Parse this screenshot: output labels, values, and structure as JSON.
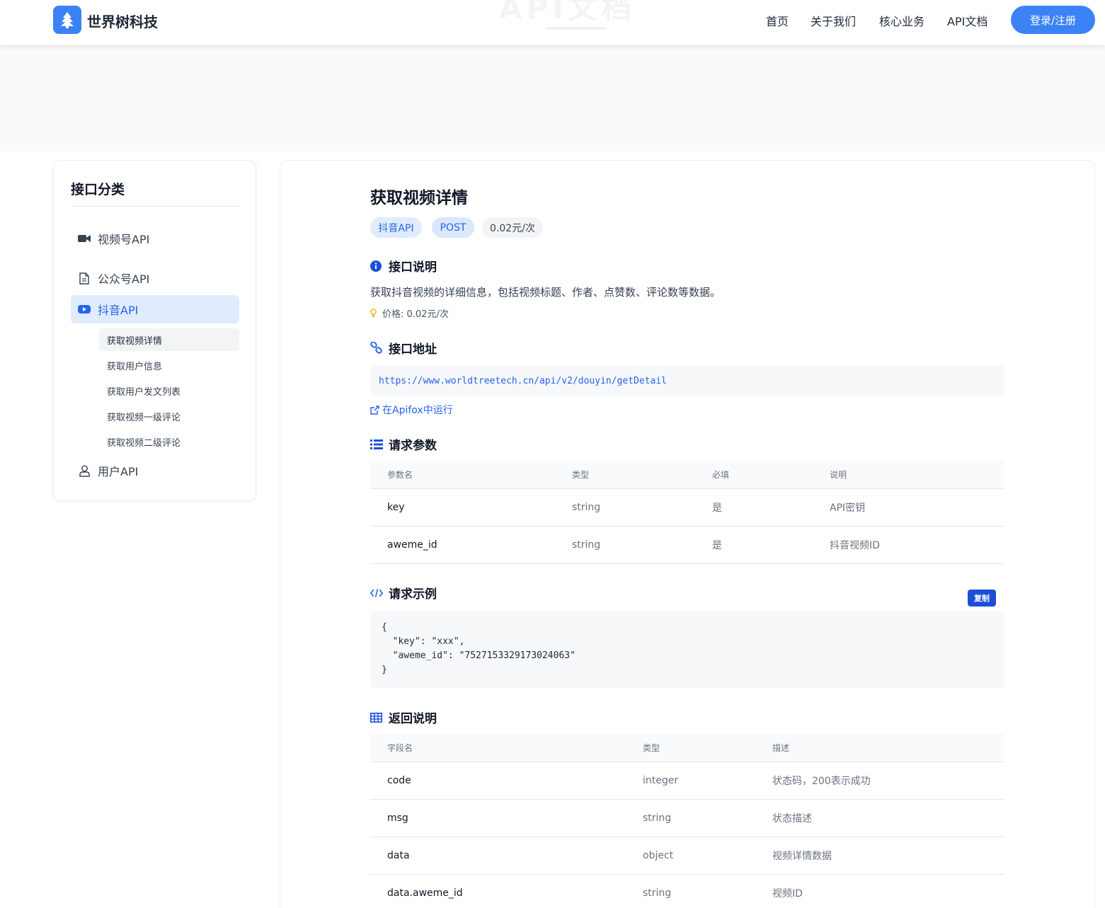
{
  "header": {
    "brand": "世界树科技",
    "nav": [
      "首页",
      "关于我们",
      "核心业务",
      "API文档"
    ],
    "login": "登录/注册",
    "ghost_title": "API文档"
  },
  "sidebar": {
    "title": "接口分类",
    "categories": [
      {
        "label": "视频号API",
        "icon": "video-camera-icon"
      },
      {
        "label": "公众号API",
        "icon": "document-icon"
      },
      {
        "label": "抖音API",
        "icon": "play-icon",
        "active": true
      },
      {
        "label": "用户API",
        "icon": "user-icon"
      }
    ],
    "douyin_subitems": [
      "获取视频详情",
      "获取用户信息",
      "获取用户发文列表",
      "获取视频一级评论",
      "获取视频二级评论"
    ],
    "active_subitem": "获取视频详情"
  },
  "main": {
    "title": "获取视频详情",
    "tags": [
      "抖音API",
      "POST",
      "0.02元/次"
    ],
    "sections": {
      "desc": "接口说明",
      "url": "接口地址",
      "params": "请求参数",
      "example": "请求示例",
      "response": "返回说明"
    },
    "description": "获取抖音视频的详细信息，包括视频标题、作者、点赞数、评论数等数据。",
    "price_note": "价格: 0.02元/次",
    "endpoint": "https://www.worldtreetech.cn/api/v2/douyin/getDetail",
    "apifox_link": "在Apifox中运行",
    "params_table": {
      "headers": [
        "参数名",
        "类型",
        "必填",
        "说明"
      ],
      "rows": [
        [
          "key",
          "string",
          "是",
          "API密钥"
        ],
        [
          "aweme_id",
          "string",
          "是",
          "抖音视频ID"
        ]
      ]
    },
    "copy_label": "复制",
    "code_example": "{\n  \"key\": \"xxx\",\n  \"aweme_id\": \"7527153329173024063\"\n}",
    "response_table": {
      "headers": [
        "字段名",
        "类型",
        "描述"
      ],
      "rows": [
        [
          "code",
          "integer",
          "状态码，200表示成功"
        ],
        [
          "msg",
          "string",
          "状态描述"
        ],
        [
          "data",
          "object",
          "视频详情数据"
        ],
        [
          "data.aweme_id",
          "string",
          "视频ID"
        ]
      ]
    }
  },
  "colors": {
    "accent": "#3b82f6",
    "link": "#2563eb",
    "copy_button": "#1d4ed8",
    "active_bg": "#e0ecfd"
  }
}
